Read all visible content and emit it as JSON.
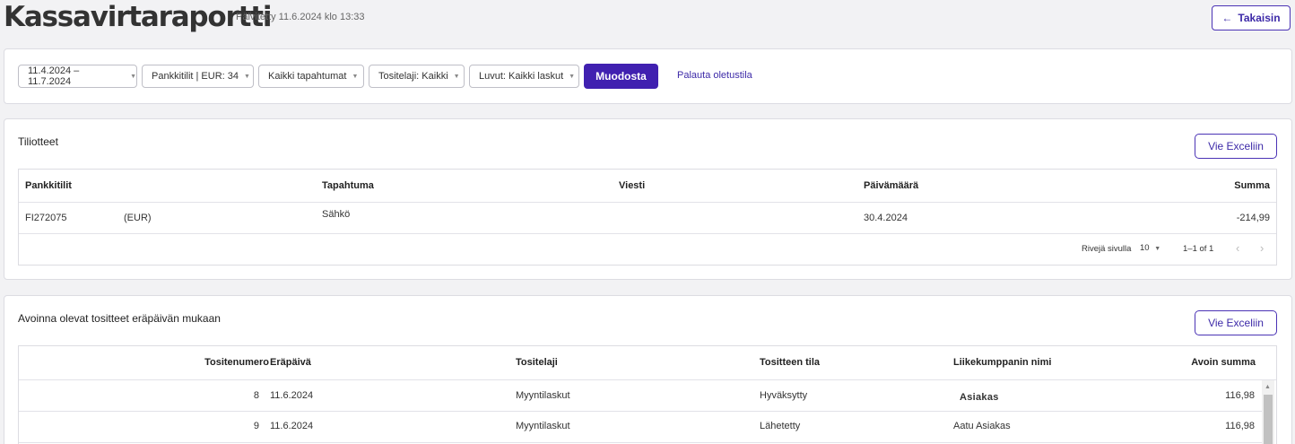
{
  "header": {
    "title": "Kassavirtaraportti",
    "updated": "Päivitetty 11.6.2024 klo 13:33",
    "back_label": "Takaisin",
    "back_icon": "arrow-left-icon"
  },
  "filters": {
    "date_range": "11.4.2024 – 11.7.2024",
    "bank_accounts": "Pankkitilit | EUR: 34",
    "events": "Kaikki tapahtumat",
    "voucher_type": "Tositelaji: Kaikki",
    "figures": "Luvut: Kaikki laskut",
    "generate_label": "Muodosta",
    "reset_label": "Palauta oletustila"
  },
  "statements": {
    "title": "Tiliotteet",
    "export_label": "Vie Exceliin",
    "columns": [
      "Pankkitilit",
      "Tapahtuma",
      "Viesti",
      "Päivämäärä",
      "Summa"
    ],
    "rows": [
      {
        "account": "FI272075",
        "currency": "(EUR)",
        "event": "Sähkö",
        "message": "",
        "date": "30.4.2024",
        "amount": "-214,99"
      }
    ],
    "pagination": {
      "rows_per_page_label": "Rivejä sivulla",
      "rows_per_page": "10",
      "range": "1–1 of 1"
    }
  },
  "open_vouchers": {
    "title": "Avoinna olevat tositteet eräpäivän mukaan",
    "export_label": "Vie Exceliin",
    "columns": [
      "Tositenumero",
      "Eräpäivä",
      "Tositelaji",
      "Tositteen tila",
      "Liikekumppanin nimi",
      "Avoin summa"
    ],
    "rows": [
      {
        "number": "8",
        "due": "11.6.2024",
        "type": "Myyntilaskut",
        "status": "Hyväksytty",
        "partner": "Asiakas",
        "amount": "116,98"
      },
      {
        "number": "9",
        "due": "11.6.2024",
        "type": "Myyntilaskut",
        "status": "Lähetetty",
        "partner": "Aatu Asiakas",
        "amount": "116,98"
      }
    ]
  },
  "colors": {
    "accent": "#4020b0",
    "link": "#3d2aa8",
    "background": "#f2f2f4"
  }
}
